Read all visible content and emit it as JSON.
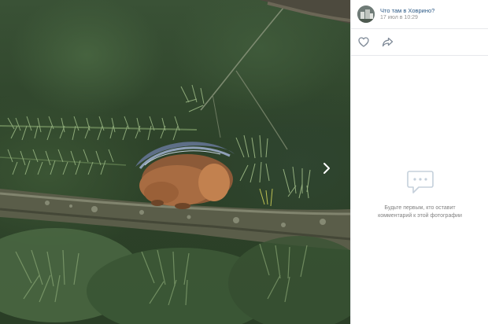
{
  "viewer": {
    "photo_subject": "squirrel-on-larch-branch",
    "next_arrow_icon": "chevron-right-icon"
  },
  "post": {
    "group_name": "Что там в Ховрино?",
    "date": "17 июл в 10:29",
    "avatar_icon": "group-avatar"
  },
  "actions": {
    "like_icon": "heart-icon",
    "share_icon": "share-icon"
  },
  "comments": {
    "empty_icon": "comment-bubble-icon",
    "empty_line1": "Будьте первым, кто оставит",
    "empty_line2": "комментарий к этой фотографии"
  },
  "colors": {
    "link": "#2a5885",
    "muted": "#939393",
    "divider": "#e7e8ec"
  }
}
